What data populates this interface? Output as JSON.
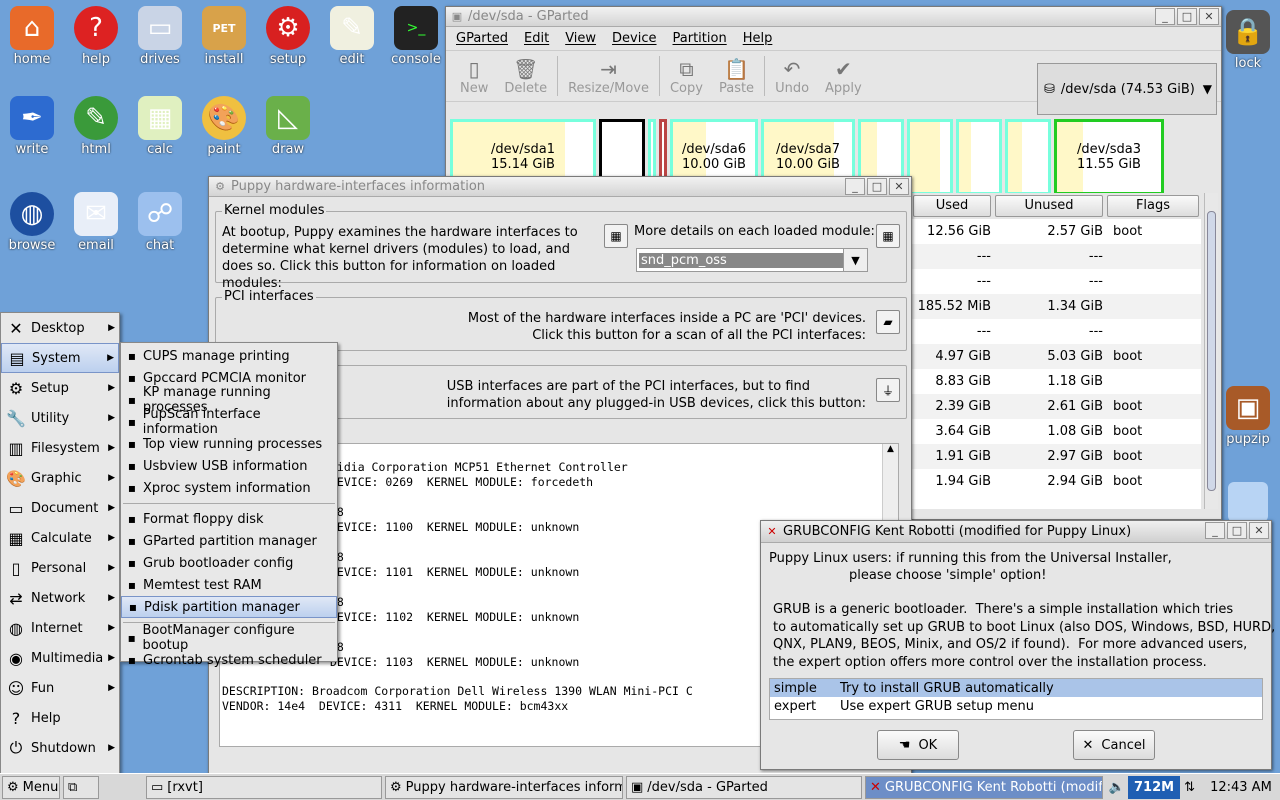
{
  "desktop": {
    "icons_left": [
      {
        "label": "home",
        "icon": "home-icon"
      },
      {
        "label": "help",
        "icon": "help-icon"
      },
      {
        "label": "drives",
        "icon": "drive-icon"
      },
      {
        "label": "install",
        "icon": "install-icon"
      },
      {
        "label": "setup",
        "icon": "setup-icon"
      },
      {
        "label": "edit",
        "icon": "edit-icon"
      },
      {
        "label": "console",
        "icon": "console-icon"
      },
      {
        "label": "write",
        "icon": "write-icon"
      },
      {
        "label": "html",
        "icon": "html-icon"
      },
      {
        "label": "calc",
        "icon": "calc-icon"
      },
      {
        "label": "paint",
        "icon": "paint-icon"
      },
      {
        "label": "draw",
        "icon": "draw-icon"
      },
      {
        "label": "browse",
        "icon": "globe-icon"
      },
      {
        "label": "email",
        "icon": "email-icon"
      },
      {
        "label": "chat",
        "icon": "chat-icon"
      }
    ],
    "lock_label": "lock",
    "pupzip_label": "pupzip"
  },
  "gparted": {
    "title": "/dev/sda - GParted",
    "menu": [
      "GParted",
      "Edit",
      "View",
      "Device",
      "Partition",
      "Help"
    ],
    "toolbar": [
      "New",
      "Delete",
      "Resize/Move",
      "Copy",
      "Paste",
      "Undo",
      "Apply"
    ],
    "device": "/dev/sda  (74.53 GiB)",
    "partitions": [
      {
        "name": "/dev/sda1",
        "size": "15.14 GiB"
      },
      {
        "name": "/dev/sda6",
        "size": "10.00 GiB"
      },
      {
        "name": "/dev/sda7",
        "size": "10.00 GiB"
      },
      {
        "name": "/dev/sda3",
        "size": "11.55 GiB"
      }
    ],
    "columns": [
      "Used",
      "Unused",
      "Flags"
    ],
    "rows": [
      [
        "12.56 GiB",
        "2.57 GiB",
        "boot"
      ],
      [
        "---",
        "---",
        ""
      ],
      [
        "---",
        "---",
        ""
      ],
      [
        "185.52 MiB",
        "1.34 GiB",
        ""
      ],
      [
        "---",
        "---",
        ""
      ],
      [
        "4.97 GiB",
        "5.03 GiB",
        "boot"
      ],
      [
        "8.83 GiB",
        "1.18 GiB",
        ""
      ],
      [
        "2.39 GiB",
        "2.61 GiB",
        "boot"
      ],
      [
        "3.64 GiB",
        "1.08 GiB",
        "boot"
      ],
      [
        "1.91 GiB",
        "2.97 GiB",
        "boot"
      ],
      [
        "1.94 GiB",
        "2.94 GiB",
        "boot"
      ]
    ]
  },
  "hw": {
    "title": "Puppy hardware-interfaces information",
    "kernel_title": "Kernel modules",
    "kernel_text": "At bootup, Puppy examines the hardware interfaces to determine what kernel drivers (modules) to load, and does so. Click this button for information on loaded modules:",
    "more_details": "More details on each loaded module:",
    "module_value": "snd_pcm_oss",
    "pci_title": "PCI interfaces",
    "pci_text1": "Most of the hardware interfaces inside a PC are 'PCI' devices.",
    "pci_text2": "Click this button for a scan of all the PCI interfaces:",
    "usb_text1": "USB interfaces are part of the PCI interfaces, but to find",
    "usb_text2": "information about any plugged-in USB devices, click this button:",
    "output": "vidia Corporation MCP51 Ethernet Controller\nDEVICE: 0269  KERNEL MODULE: forcedeth\n\n78\nDEVICE: 1100  KERNEL MODULE: unknown\n\n78\nDEVICE: 1101  KERNEL MODULE: unknown\n\n78\nDEVICE: 1102  KERNEL MODULE: unknown\n\n78\nDEVICE: 1103  KERNEL MODULE: unknown",
    "output2": "DESCRIPTION: Broadcom Corporation Dell Wireless 1390 WLAN Mini-PCI C\nVENDOR: 14e4  DEVICE: 4311  KERNEL MODULE: bcm43xx"
  },
  "mainmenu": [
    {
      "label": "Desktop",
      "icon": "desktop-icon",
      "sub": true
    },
    {
      "label": "System",
      "icon": "system-icon",
      "sub": true
    },
    {
      "label": "Setup",
      "icon": "setup-icon",
      "sub": true
    },
    {
      "label": "Utility",
      "icon": "utility-icon",
      "sub": true
    },
    {
      "label": "Filesystem",
      "icon": "filesystem-icon",
      "sub": true
    },
    {
      "label": "Graphic",
      "icon": "graphic-icon",
      "sub": true
    },
    {
      "label": "Document",
      "icon": "document-icon",
      "sub": true
    },
    {
      "label": "Calculate",
      "icon": "calculate-icon",
      "sub": true
    },
    {
      "label": "Personal",
      "icon": "personal-icon",
      "sub": true
    },
    {
      "label": "Network",
      "icon": "network-icon",
      "sub": true
    },
    {
      "label": "Internet",
      "icon": "internet-icon",
      "sub": true
    },
    {
      "label": "Multimedia",
      "icon": "multimedia-icon",
      "sub": true
    },
    {
      "label": "Fun",
      "icon": "fun-icon",
      "sub": true
    },
    {
      "label": "Help",
      "icon": "help-icon",
      "sub": false
    },
    {
      "label": "Shutdown",
      "icon": "shutdown-icon",
      "sub": true
    }
  ],
  "systemmenu": {
    "group1": [
      "CUPS manage printing",
      "Gpccard PCMCIA monitor",
      "KP manage running processes",
      "PupScan interface information",
      "Top view running processes",
      "Usbview USB information",
      "Xproc system information"
    ],
    "group2": [
      "Format floppy disk",
      "GParted partition manager",
      "Grub bootloader config",
      "Memtest test RAM",
      "Pdisk partition manager"
    ],
    "group3": [
      "BootManager configure bootup",
      "Gcrontab system scheduler"
    ]
  },
  "grub": {
    "title": "GRUBCONFIG Kent Robotti (modified for Puppy Linux)",
    "line1": "Puppy Linux users: if running this from the Universal Installer,",
    "line2": "please choose 'simple' option!",
    "desc": "GRUB is a generic bootloader.  There's a simple installation which tries\nto automatically set up GRUB to boot Linux (also DOS, Windows, BSD, HURD,\nQNX, PLAN9, BEOS, Minix, and OS/2 if found).  For more advanced users,\nthe expert option offers more control over the installation process.",
    "options": [
      {
        "key": "simple",
        "desc": "Try to install GRUB automatically"
      },
      {
        "key": "expert",
        "desc": "Use expert GRUB setup menu"
      }
    ],
    "ok": "OK",
    "cancel": "Cancel"
  },
  "taskbar": {
    "menu": "Menu",
    "tasks": [
      "[rxvt]",
      "Puppy hardware-interfaces informatio",
      "/dev/sda - GParted",
      "GRUBCONFIG Kent Robotti (modifie"
    ],
    "mem": "712M",
    "clock": "12:43 AM"
  },
  "colors": {
    "desktop": "#6fa1d8",
    "selection": "#aac4e8",
    "active_task": "#6d8ec7"
  }
}
